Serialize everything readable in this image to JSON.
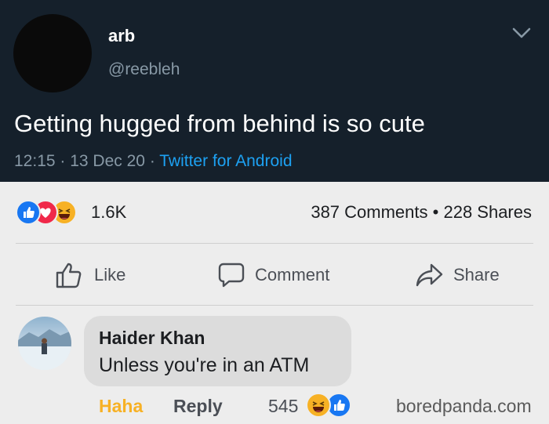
{
  "tweet": {
    "display_name": "arb",
    "handle": "@reebleh",
    "text": "Getting hugged from behind is so cute",
    "time": "12:15",
    "date": "13 Dec 20",
    "source": "Twitter for Android",
    "icons": {
      "menu": "chevron-down-icon"
    }
  },
  "facebook": {
    "reaction_count": "1.6K",
    "comments": "387 Comments",
    "shares": "228 Shares",
    "reaction_icons": [
      "like-reaction-icon",
      "love-reaction-icon",
      "haha-reaction-icon"
    ],
    "actions": {
      "like": "Like",
      "comment": "Comment",
      "share": "Share"
    },
    "colors": {
      "like_blue": "#1877f2",
      "love_red": "#f02849",
      "haha_yellow": "#f7b125"
    }
  },
  "comment": {
    "author": "Haider Khan",
    "text": "Unless you're in an ATM",
    "reaction_label": "Haha",
    "reply_label": "Reply",
    "reaction_count": "545"
  },
  "watermark": "boredpanda.com"
}
